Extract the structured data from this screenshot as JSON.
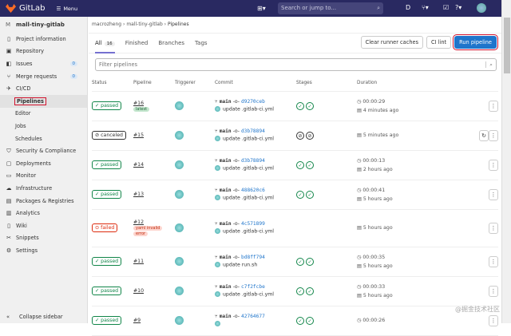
{
  "topbar": {
    "brand": "GitLab",
    "menu": "Menu",
    "search_placeholder": "Search or jump to..."
  },
  "sidebar": {
    "project": "mall-tiny-gitlab",
    "project_initial": "M",
    "items": [
      {
        "label": "Project information",
        "icon": "info-icon"
      },
      {
        "label": "Repository",
        "icon": "doc-icon"
      },
      {
        "label": "Issues",
        "icon": "issues-icon",
        "count": "0"
      },
      {
        "label": "Merge requests",
        "icon": "merge-icon",
        "count": "0"
      },
      {
        "label": "CI/CD",
        "icon": "rocket-icon"
      }
    ],
    "cicd_sub": [
      "Pipelines",
      "Editor",
      "Jobs",
      "Schedules"
    ],
    "items2": [
      {
        "label": "Security & Compliance",
        "icon": "shield-icon"
      },
      {
        "label": "Deployments",
        "icon": "deploy-icon"
      },
      {
        "label": "Monitor",
        "icon": "monitor-icon"
      },
      {
        "label": "Infrastructure",
        "icon": "cloud-icon"
      },
      {
        "label": "Packages & Registries",
        "icon": "package-icon"
      },
      {
        "label": "Analytics",
        "icon": "chart-icon"
      },
      {
        "label": "Wiki",
        "icon": "book-icon"
      },
      {
        "label": "Snippets",
        "icon": "scissors-icon"
      },
      {
        "label": "Settings",
        "icon": "gear-icon"
      }
    ],
    "collapse": "Collapse sidebar"
  },
  "breadcrumb": [
    "macrozheng",
    "mall-tiny-gitlab",
    "Pipelines"
  ],
  "tabs": [
    {
      "label": "All",
      "count": "16"
    },
    {
      "label": "Finished"
    },
    {
      "label": "Branches"
    },
    {
      "label": "Tags"
    }
  ],
  "buttons": {
    "clear": "Clear runner caches",
    "lint": "CI lint",
    "run": "Run pipeline"
  },
  "filter_placeholder": "Filter pipelines",
  "columns": [
    "Status",
    "Pipeline",
    "Triggerer",
    "Commit",
    "Stages",
    "Duration"
  ],
  "rows": [
    {
      "status": "passed",
      "id": "#16",
      "labels": [
        "latest"
      ],
      "branch": "main",
      "sha": "d9270ceb",
      "msg": "update .gitlab-ci.yml",
      "stages": "passed",
      "duration": "00:00:29",
      "ago": "4 minutes ago"
    },
    {
      "status": "canceled",
      "id": "#15",
      "labels": [],
      "branch": "main",
      "sha": "d3b78894",
      "msg": "update .gitlab-ci.yml",
      "stages": "canceled",
      "duration": "",
      "ago": "5 minutes ago",
      "retry": true
    },
    {
      "status": "passed",
      "id": "#14",
      "labels": [],
      "branch": "main",
      "sha": "d3b78894",
      "msg": "update .gitlab-ci.yml",
      "stages": "passed",
      "duration": "00:00:13",
      "ago": "2 hours ago"
    },
    {
      "status": "passed",
      "id": "#13",
      "labels": [],
      "branch": "main",
      "sha": "488620c6",
      "msg": "update .gitlab-ci.yml",
      "stages": "passed",
      "duration": "00:00:41",
      "ago": "5 hours ago"
    },
    {
      "status": "failed",
      "id": "#12",
      "labels": [
        "yaml invalid",
        "error"
      ],
      "branch": "main",
      "sha": "4c571899",
      "msg": "update .gitlab-ci.yml",
      "stages": "",
      "duration": "",
      "ago": "5 hours ago"
    },
    {
      "status": "passed",
      "id": "#11",
      "labels": [],
      "branch": "main",
      "sha": "bd8ff794",
      "msg": "update run.sh",
      "stages": "passed",
      "duration": "00:00:35",
      "ago": "5 hours ago"
    },
    {
      "status": "passed",
      "id": "#10",
      "labels": [],
      "branch": "main",
      "sha": "c7f2fcbe",
      "msg": "update .gitlab-ci.yml",
      "stages": "passed",
      "duration": "00:00:33",
      "ago": "5 hours ago"
    },
    {
      "status": "passed",
      "id": "#9",
      "labels": [],
      "branch": "main",
      "sha": "42764677",
      "msg": "",
      "stages": "passed",
      "duration": "00:00:26",
      "ago": ""
    }
  ],
  "watermark": "@掘金技术社区"
}
